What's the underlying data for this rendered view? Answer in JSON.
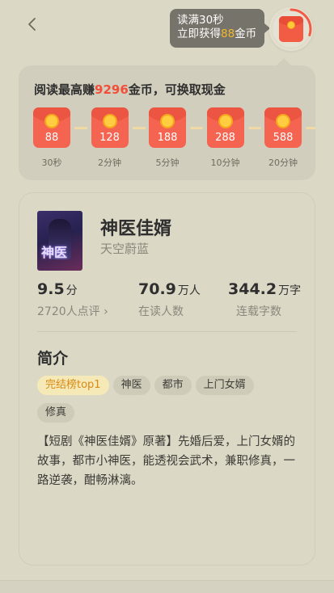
{
  "header": {
    "tip_line1": "读满30秒",
    "tip_line2_prefix": "立即获得",
    "tip_line2_coins": "88",
    "tip_line2_suffix": "金币",
    "timer_progress": 0.3
  },
  "rewards": {
    "title_prefix": "阅读最高赚",
    "title_amount": "9296",
    "title_suffix": "金币，可换取现金",
    "items": [
      {
        "amount": "88",
        "time": "30秒"
      },
      {
        "amount": "128",
        "time": "2分钟"
      },
      {
        "amount": "188",
        "time": "5分钟"
      },
      {
        "amount": "288",
        "time": "10分钟"
      },
      {
        "amount": "588",
        "time": "20分钟"
      }
    ]
  },
  "book": {
    "title": "神医佳婿",
    "author": "天空蔚蓝",
    "cover_text": "神医",
    "rating": "9.5",
    "rating_unit": "分",
    "rating_count": "2720人点评",
    "readers": "70.9",
    "readers_unit": "万人",
    "readers_label": "在读人数",
    "words": "344.2",
    "words_unit": "万字",
    "words_label": "连载字数"
  },
  "intro": {
    "title": "简介",
    "tags": [
      "完结榜top1",
      "神医",
      "都市",
      "上门女婿",
      "修真"
    ],
    "description": "【短剧《神医佳婿》原著】先婚后爱，上门女婿的故事，都市小神医，能透视会武术，兼职修真，一路逆袭，酣畅淋漓。"
  },
  "colors": {
    "background": "#dcd8c6",
    "accent_red": "#f24f3a",
    "gold": "#f4b72c"
  }
}
